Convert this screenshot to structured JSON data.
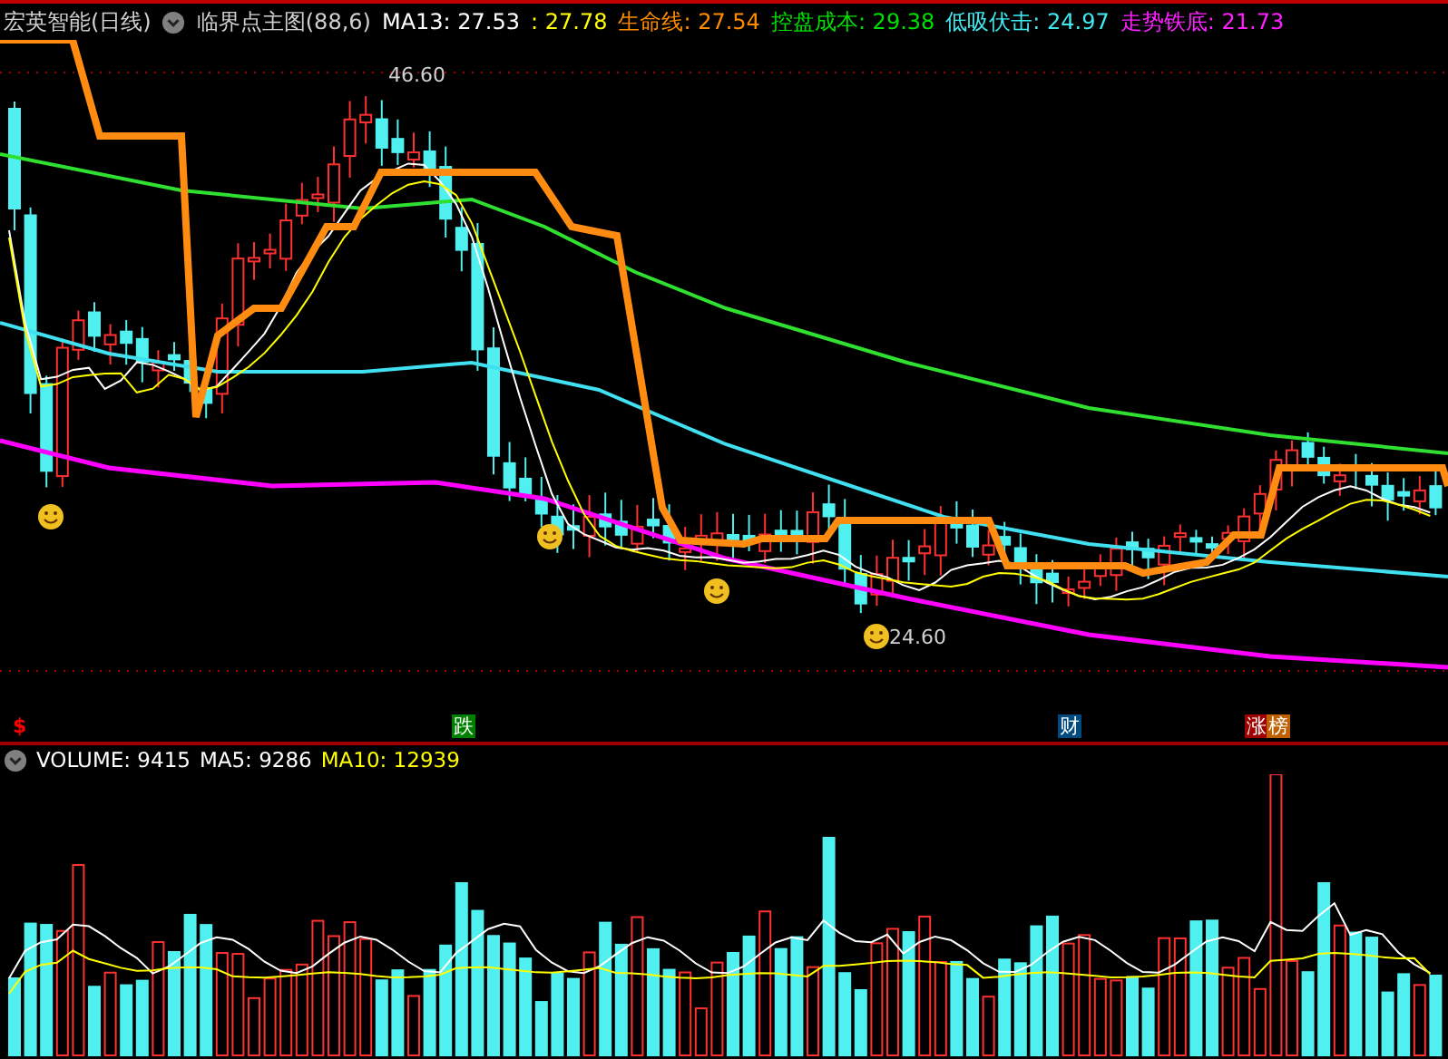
{
  "header": {
    "stock": "宏英智能(日线)",
    "indicator": "临界点主图(88,6)",
    "values": [
      {
        "text": "MA13: 27.53",
        "color": "#ffffff"
      },
      {
        "text": ": 27.78",
        "color": "#ffff00"
      },
      {
        "text": "生命线: 27.54",
        "color": "#ff8c00"
      },
      {
        "text": "控盘成本: 29.38",
        "color": "#00e000"
      },
      {
        "text": "低吸伏击: 24.97",
        "color": "#40e8f0"
      },
      {
        "text": "走势铁底: 21.73",
        "color": "#ff20ff"
      }
    ]
  },
  "price_chart": {
    "high_label": "46.60",
    "low_label": "24.60"
  },
  "markers": [
    {
      "kind": "signal",
      "text": "$",
      "color": "#ff0000"
    },
    {
      "kind": "tag",
      "text": "跌",
      "color": "#008000"
    },
    {
      "kind": "tag",
      "text": "财",
      "color": "#004a80"
    },
    {
      "kind": "tag",
      "text": "涨",
      "color": "#a00000"
    },
    {
      "kind": "tag",
      "text": "榜",
      "color": "#c06000"
    }
  ],
  "volume_header": {
    "values": [
      {
        "text": "VOLUME: 9415",
        "color": "#ffffff"
      },
      {
        "text": "MA5: 9286",
        "color": "#ffffff"
      },
      {
        "text": "MA10: 12939",
        "color": "#ffff00"
      }
    ]
  }
}
